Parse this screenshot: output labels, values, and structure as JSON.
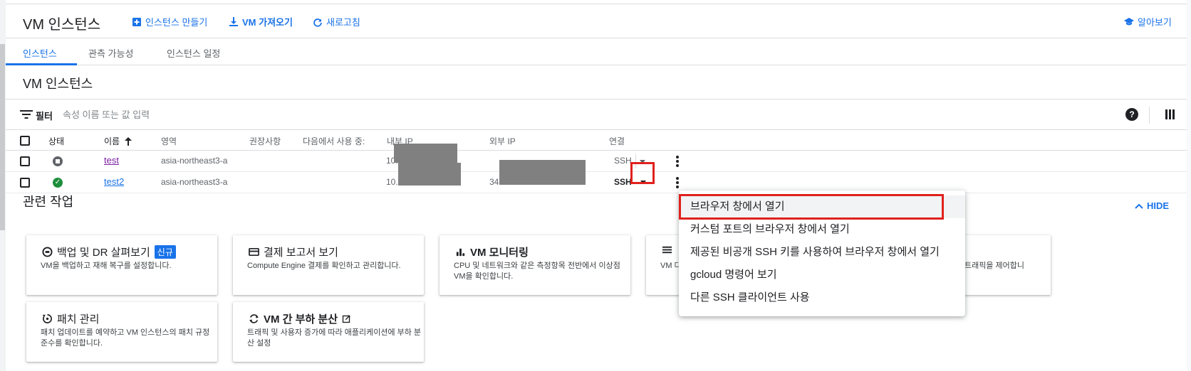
{
  "header": {
    "title": "VM 인스턴스",
    "create_label": "인스턴스 만들기",
    "import_label": "VM 가져오기",
    "refresh_label": "새로고침",
    "learn_label": "알아보기"
  },
  "tabs": [
    {
      "label": "인스턴스",
      "active": true
    },
    {
      "label": "관측 가능성",
      "active": false
    },
    {
      "label": "인스턴스 일정",
      "active": false
    }
  ],
  "section_title": "VM 인스턴스",
  "filter": {
    "label": "필터",
    "placeholder": "속성 이름 또는 값 입력"
  },
  "table": {
    "headers": {
      "status": "상태",
      "name": "이름",
      "zone": "영역",
      "recommendation": "권장사항",
      "in_use_by": "다음에서 사용 중:",
      "internal_ip": "내부 IP",
      "external_ip": "외부 IP",
      "connect": "연결"
    },
    "rows": [
      {
        "status": "stopped",
        "name": "test",
        "zone": "asia-northeast3-a",
        "internal_ip": "10.",
        "external_ip": "",
        "connect": "SSH"
      },
      {
        "status": "running",
        "name": "test2",
        "zone": "asia-northeast3-a",
        "internal_ip": "10.",
        "external_ip": "34",
        "connect": "SSH"
      }
    ]
  },
  "related": {
    "title": "관련 작업",
    "hide_label": "HIDE",
    "new_badge": "신규",
    "cards": [
      {
        "title": "백업 및 DR 살펴보기",
        "desc": "VM을 백업하고 재해 복구를 설정합니다.",
        "icon": "backup-icon"
      },
      {
        "title": "결제 보고서 보기",
        "desc": "Compute Engine 결제를 확인하고 관리합니다.",
        "icon": "billing-icon"
      },
      {
        "title": "VM 모니터링",
        "desc": "CPU 및 네트워크와 같은 측정항목 전반에서 이상점 VM을 확인합니다.",
        "icon": "monitoring-icon"
      },
      {
        "title": "",
        "desc": "VM 다운",
        "icon": "logs-icon"
      },
      {
        "title": "",
        "desc": "트래픽을 제어합니",
        "icon": "firewall-icon"
      },
      {
        "title": "패치 관리",
        "desc": "패치 업데이트를 예약하고 VM 인스턴스의 패치 규정 준수를 확인합니다.",
        "icon": "patch-icon"
      },
      {
        "title": "VM 간 부하 분산",
        "desc": "트래픽 및 사용자 증가에 따라 애플리케이션에 부하 분산 설정",
        "icon": "load-balance-icon"
      }
    ]
  },
  "ssh_menu": {
    "items": [
      "브라우저 창에서 열기",
      "커스텀 포트의 브라우저 창에서 열기",
      "제공된 비공개 SSH 키를 사용하여 브라우저 창에서 열기",
      "gcloud 명령어 보기",
      "다른 SSH 클라이언트 사용"
    ]
  },
  "colors": {
    "accent": "#1a73e8",
    "highlight_box": "#e0211d",
    "running": "#1e8e3e",
    "redaction": "#808080"
  }
}
